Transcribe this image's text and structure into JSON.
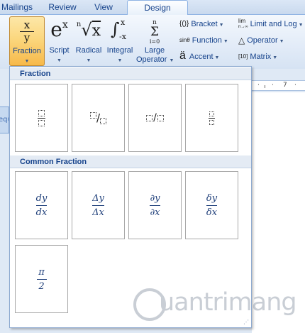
{
  "tabs": [
    "Mailings",
    "Review",
    "View",
    "Design"
  ],
  "ribbon": {
    "large_buttons": [
      {
        "label": "Fraction",
        "icon": "fraction-icon"
      },
      {
        "label": "Script",
        "icon": "script-icon"
      },
      {
        "label": "Radical",
        "icon": "radical-icon"
      },
      {
        "label": "Integral",
        "icon": "integral-icon"
      },
      {
        "label_line1": "Large",
        "label_line2": "Operator",
        "icon": "large-operator-icon"
      }
    ],
    "small_buttons": [
      {
        "label": "Bracket",
        "icon_text": "{()}"
      },
      {
        "label": "Function",
        "icon_text": "sinθ"
      },
      {
        "label": "Accent",
        "icon_text": "ä"
      },
      {
        "label": "Limit and Log",
        "icon_text": "lim"
      },
      {
        "label": "Operator",
        "icon_text": "△"
      },
      {
        "label": "Matrix",
        "icon_text": "[10]"
      }
    ],
    "icon_glyphs": {
      "fraction_num": "x",
      "fraction_den": "y",
      "script_base": "e",
      "script_sup": "x",
      "radical_index": "n",
      "radical_body": "x",
      "integral_sign": "∫",
      "integral_upper": "x",
      "integral_lower": "-x",
      "large_op_top": "n",
      "large_op_sign": "Σ",
      "large_op_bottom": "i=0",
      "lim_top": "lim",
      "lim_bottom": "n→∞"
    }
  },
  "ruler": {
    "mark_7": "7",
    "mark_dot": "·"
  },
  "left_stub_text": "equ",
  "gallery": {
    "sections": [
      {
        "title": "Fraction"
      },
      {
        "title": "Common Fraction"
      }
    ],
    "common_fractions": [
      {
        "num": "dy",
        "den": "dx"
      },
      {
        "num": "Δy",
        "den": "Δx"
      },
      {
        "num": "∂y",
        "den": "∂x"
      },
      {
        "num": "δy",
        "den": "δx"
      },
      {
        "num": "π",
        "den": "2"
      }
    ],
    "slash": "/"
  },
  "watermark": "uantrimang"
}
